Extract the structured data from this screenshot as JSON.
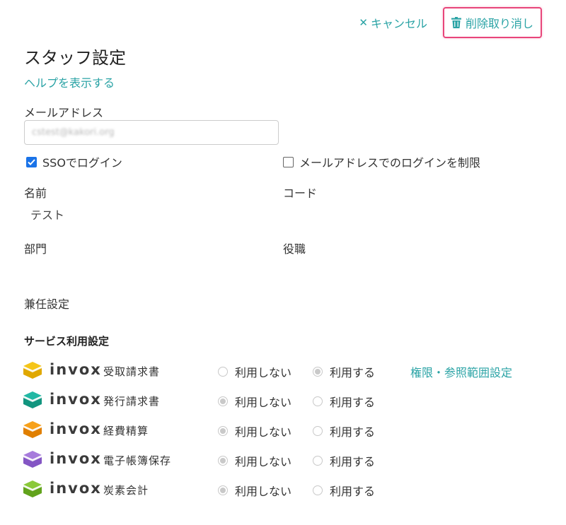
{
  "header": {
    "cancel_label": "キャンセル",
    "undo_delete_label": "削除取り消し"
  },
  "page": {
    "title": "スタッフ設定",
    "help_link": "ヘルプを表示する"
  },
  "form": {
    "email_label": "メールアドレス",
    "email_value": "cstest@kakori.org",
    "sso_label": "SSOでログイン",
    "sso_checked": true,
    "restrict_label": "メールアドレスでのログインを制限",
    "restrict_checked": false,
    "name_label": "名前",
    "name_value": "テスト",
    "code_label": "コード",
    "dept_label": "部門",
    "position_label": "役職",
    "concurrent_label": "兼任設定"
  },
  "services": {
    "title": "サービス利用設定",
    "brand": "invox",
    "option_off": "利用しない",
    "option_on": "利用する",
    "items": [
      {
        "name": "受取請求書",
        "selected": "on",
        "color_top": "#f5c518",
        "color_bottom": "#e0a800",
        "link": "権限・参照範囲設定"
      },
      {
        "name": "発行請求書",
        "selected": "off",
        "color_top": "#22b8a4",
        "color_bottom": "#12957f"
      },
      {
        "name": "経費精算",
        "selected": "off",
        "color_top": "#f7a11a",
        "color_bottom": "#e07f00"
      },
      {
        "name": "電子帳簿保存",
        "selected": "off",
        "color_top": "#a77bdc",
        "color_bottom": "#8456c4"
      },
      {
        "name": "炭素会計",
        "selected": "off",
        "color_top": "#8bc93a",
        "color_bottom": "#62a31c"
      }
    ]
  },
  "colors": {
    "accent": "#2aa3a5",
    "highlight_border": "#e8457a",
    "checkbox": "#1a73e8"
  }
}
